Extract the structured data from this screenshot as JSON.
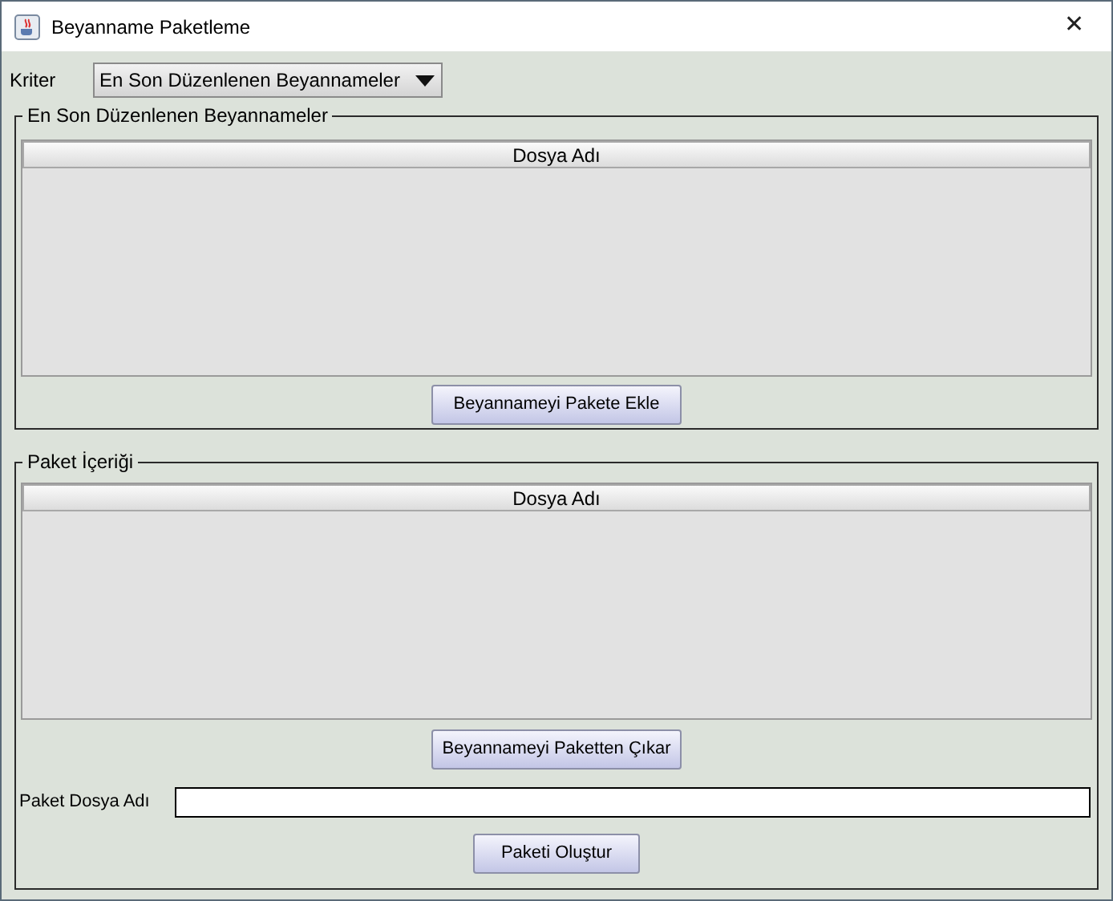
{
  "window": {
    "title": "Beyanname Paketleme",
    "close": "✕"
  },
  "criteria": {
    "label": "Kriter",
    "value": "En Son Düzenlenen Beyannameler"
  },
  "recent_group": {
    "title": "En Son Düzenlenen Beyannameler",
    "table": {
      "columns": [
        "Dosya Adı"
      ]
    },
    "button": "Beyannameyi Pakete Ekle"
  },
  "package_group": {
    "title": "Paket İçeriği",
    "table": {
      "columns": [
        "Dosya Adı"
      ]
    },
    "button": "Beyannameyi Paketten Çıkar",
    "file_name": {
      "label": "Paket Dosya Adı"
    },
    "create_button": "Paketi Oluştur"
  }
}
